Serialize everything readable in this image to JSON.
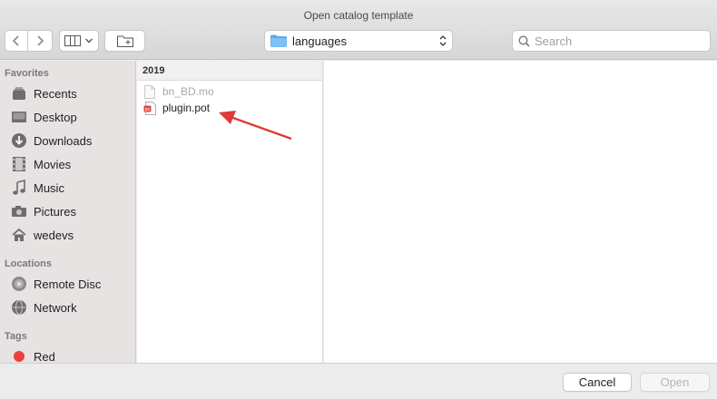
{
  "window": {
    "title": "Open catalog template"
  },
  "toolbar": {
    "location": "languages",
    "search_placeholder": "Search"
  },
  "sidebar": {
    "favorites_heading": "Favorites",
    "favorites": [
      {
        "label": "Recents",
        "icon": "recents-icon"
      },
      {
        "label": "Desktop",
        "icon": "desktop-icon"
      },
      {
        "label": "Downloads",
        "icon": "downloads-icon"
      },
      {
        "label": "Movies",
        "icon": "movies-icon"
      },
      {
        "label": "Music",
        "icon": "music-icon"
      },
      {
        "label": "Pictures",
        "icon": "pictures-icon"
      },
      {
        "label": "wedevs",
        "icon": "home-icon"
      }
    ],
    "locations_heading": "Locations",
    "locations": [
      {
        "label": "Remote Disc",
        "icon": "disc-icon"
      },
      {
        "label": "Network",
        "icon": "network-icon"
      }
    ],
    "tags_heading": "Tags",
    "tags": [
      {
        "label": "Red",
        "color": "#e8413c"
      }
    ]
  },
  "browser": {
    "column_header": "2019",
    "files": [
      {
        "name": "bn_BD.mo",
        "enabled": false
      },
      {
        "name": "plugin.pot",
        "enabled": true
      }
    ]
  },
  "footer": {
    "cancel_label": "Cancel",
    "open_label": "Open"
  },
  "colors": {
    "folder_accent": "#5ab0f3",
    "annotation_arrow": "#e03a3a",
    "tag_red": "#e8413c"
  }
}
